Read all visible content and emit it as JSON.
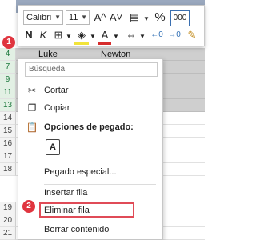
{
  "sheet": {
    "rows": [
      "4",
      "7",
      "9",
      "11",
      "13",
      "14",
      "15",
      "16",
      "17",
      "18",
      "19",
      "20",
      "21"
    ],
    "cells": {
      "c1": "Luke",
      "c2": "Newton"
    }
  },
  "minibar": {
    "font_name": "Calibri",
    "font_size": "11",
    "grow_label": "A^",
    "shrink_label": "A˅",
    "bold": "N",
    "italic": "K",
    "percent": "%",
    "thousands": "000",
    "font_color_label": "A"
  },
  "menu": {
    "search_placeholder": "Búsqueda",
    "items": {
      "cut": "Cortar",
      "copy": "Copiar",
      "paste_options": "Opciones de pegado:",
      "paste_special": "Pegado especial...",
      "insert_row": "Insertar fila",
      "delete_row": "Eliminar fila",
      "clear_contents": "Borrar contenido"
    }
  },
  "badges": {
    "step1": "1",
    "step2": "2"
  },
  "colors": {
    "badge": "#e0353f",
    "highlight": "#e04b57",
    "header_fill": "#9aa8be",
    "row_selected": "#cfcfcf",
    "row_number_selected": "#1e7a3e"
  }
}
